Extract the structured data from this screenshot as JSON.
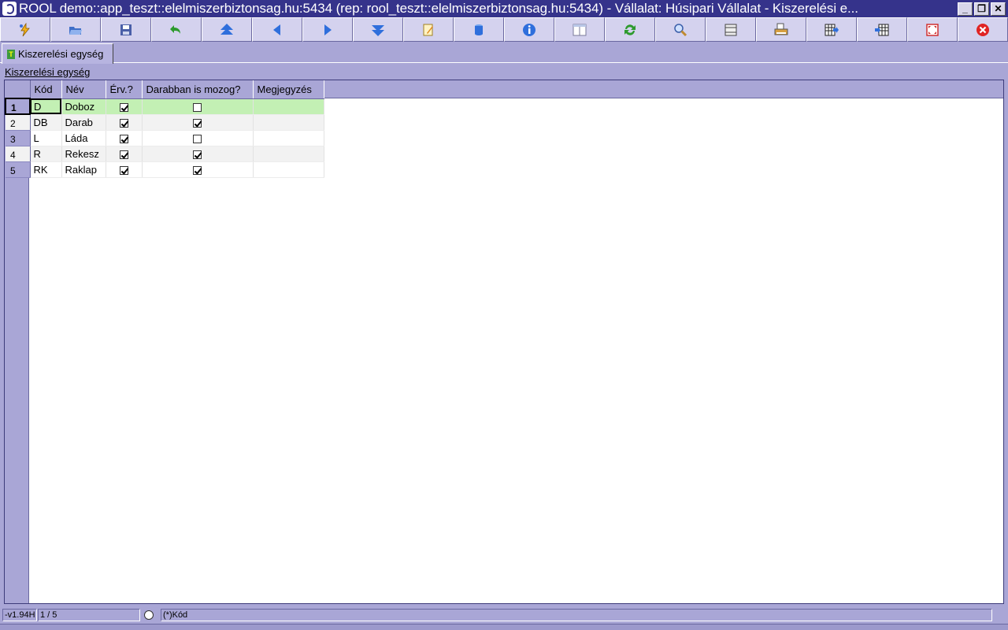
{
  "window": {
    "title": "ROOL demo::app_teszt::elelmiszerbiztonsag.hu:5434 (rep: rool_teszt::elelmiszerbiztonsag.hu:5434) - Vállalat: Húsipari Vállalat - Kiszerelési e...",
    "minimize": "_",
    "restore": "❐",
    "close": "✕"
  },
  "toolbar": {
    "buttons": [
      "lightning-icon",
      "open-folder-icon",
      "save-icon",
      "undo-icon",
      "first-record-icon",
      "previous-icon",
      "next-icon",
      "last-record-icon",
      "edit-icon",
      "database-icon",
      "info-icon",
      "split-view-icon",
      "refresh-icon",
      "search-icon",
      "columns-icon",
      "print-icon",
      "grid-export-icon",
      "grid-import-icon",
      "maximize-icon",
      "close-window-icon"
    ]
  },
  "tab": {
    "label": "Kiszerelési egység",
    "icon_letter": "T"
  },
  "group_label": "Kiszerelési egység",
  "grid": {
    "columns": [
      "Kód",
      "Név",
      "Érv.?",
      "Darabban is mozog?",
      "Megjegyzés"
    ],
    "rows": [
      {
        "num": "1",
        "kod": "D",
        "nev": "Doboz",
        "erv": true,
        "darabban": false,
        "megjegyzes": ""
      },
      {
        "num": "2",
        "kod": "DB",
        "nev": "Darab",
        "erv": true,
        "darabban": true,
        "megjegyzes": ""
      },
      {
        "num": "3",
        "kod": "L",
        "nev": "Láda",
        "erv": true,
        "darabban": false,
        "megjegyzes": ""
      },
      {
        "num": "4",
        "kod": "R",
        "nev": "Rekesz",
        "erv": true,
        "darabban": true,
        "megjegyzes": ""
      },
      {
        "num": "5",
        "kod": "RK",
        "nev": "Raklap",
        "erv": true,
        "darabban": true,
        "megjegyzes": ""
      }
    ],
    "selected_row": 1
  },
  "status": {
    "version": "-v1.94H",
    "position": "1 / 5",
    "sort": "(*)Kód"
  },
  "colors": {
    "background": "#a9a6d6",
    "titlebar": "#35338b",
    "selected_row": "#c3f0b4"
  }
}
